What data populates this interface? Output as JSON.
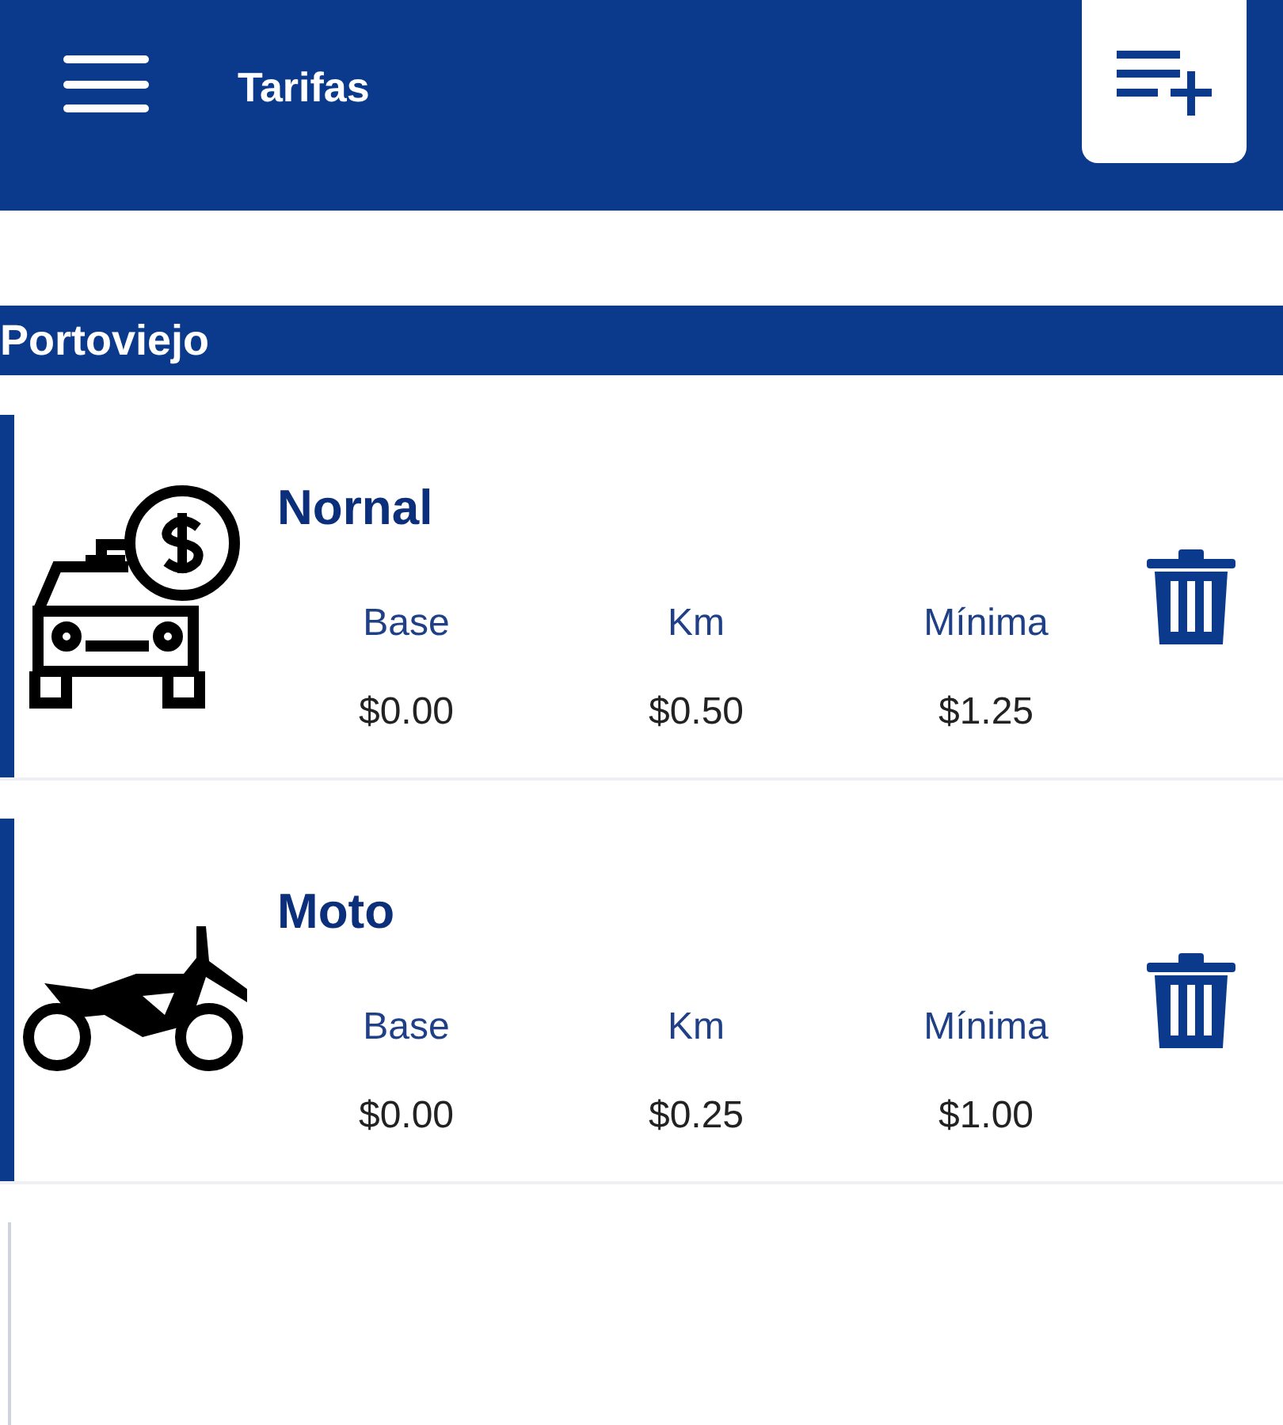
{
  "header": {
    "title": "Tarifas"
  },
  "section": {
    "title": "Portoviejo"
  },
  "tarifas": [
    {
      "name": "Nornal",
      "kind": "car",
      "fields": [
        {
          "label": "Base",
          "value": "$0.00"
        },
        {
          "label": "Km",
          "value": "$0.50"
        },
        {
          "label": "Mínima",
          "value": "$1.25"
        }
      ]
    },
    {
      "name": "Moto",
      "kind": "moto",
      "fields": [
        {
          "label": "Base",
          "value": "$0.00"
        },
        {
          "label": "Km",
          "value": "$0.25"
        },
        {
          "label": "Mínima",
          "value": "$1.00"
        }
      ]
    }
  ]
}
